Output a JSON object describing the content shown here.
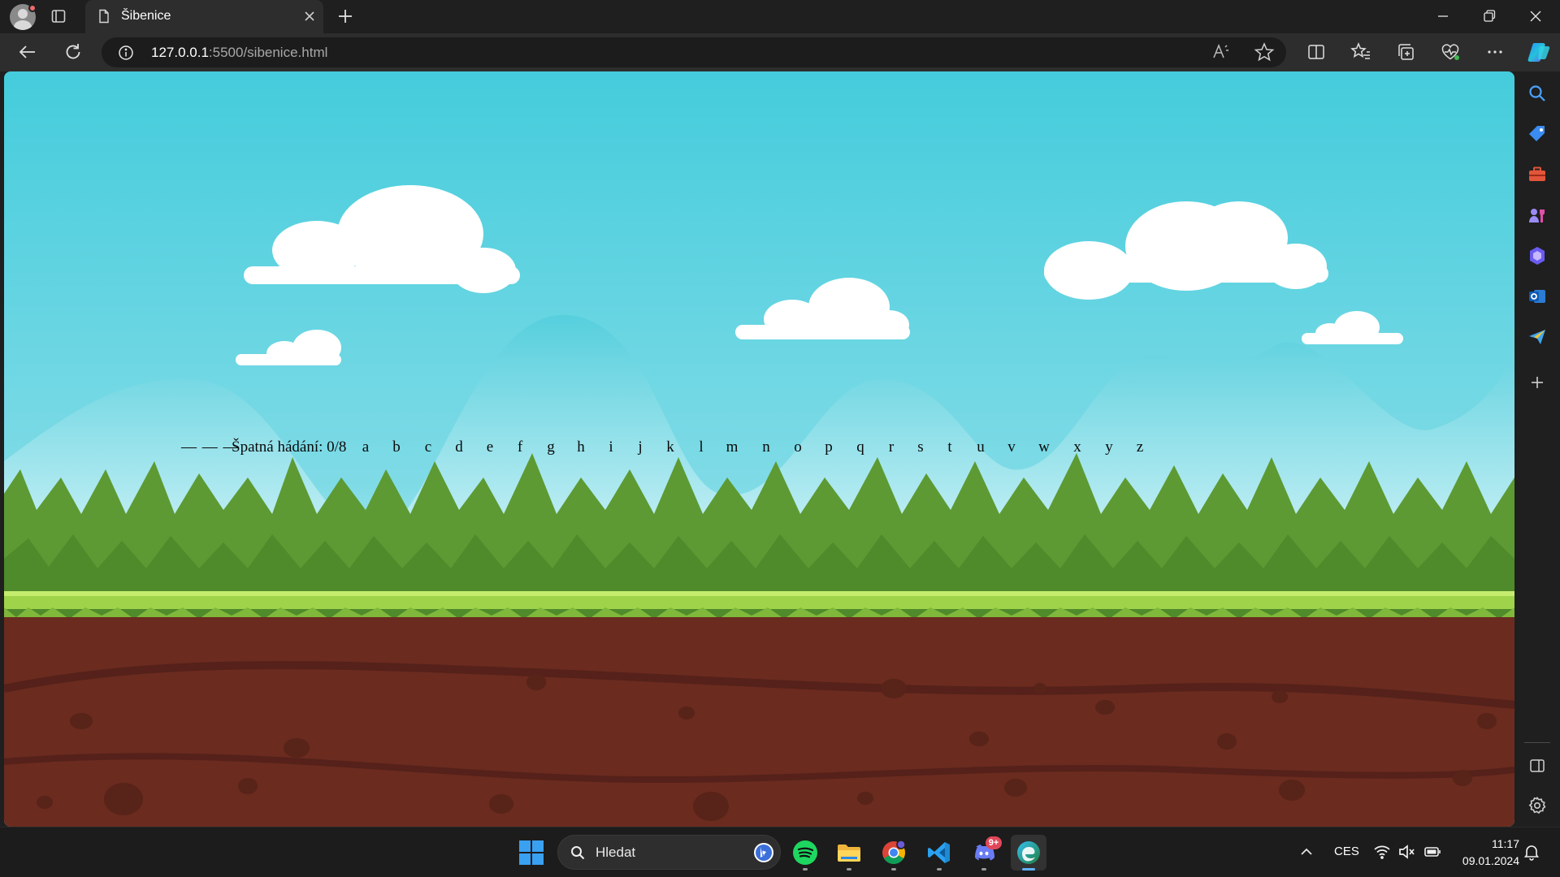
{
  "browser": {
    "tab": {
      "title": "Šibenice",
      "favicon": "document-icon"
    },
    "address": {
      "host": "127.0.0.1",
      "path": ":5500/sibenice.html"
    }
  },
  "page": {
    "word_blanks": "— — —",
    "wrong_guesses_text": "Špatná hádání: 0/8",
    "wrong_guesses_count": 0,
    "wrong_guesses_max": 8,
    "letters": [
      "a",
      "b",
      "c",
      "d",
      "e",
      "f",
      "g",
      "h",
      "i",
      "j",
      "k",
      "l",
      "m",
      "n",
      "o",
      "p",
      "q",
      "r",
      "s",
      "t",
      "u",
      "v",
      "w",
      "x",
      "y",
      "z"
    ]
  },
  "taskbar": {
    "search_placeholder": "Hledat",
    "apps": [
      "spotify-icon",
      "file-explorer-icon",
      "chrome-icon",
      "vscode-icon",
      "discord-icon",
      "edge-icon"
    ],
    "discord_badge": "9+",
    "language": "CES",
    "time": "11:17",
    "date": "09.01.2024"
  },
  "colors": {
    "sky": "#4ecfdc",
    "grass": "#5a9a2e",
    "soil": "#6b2b1f"
  }
}
